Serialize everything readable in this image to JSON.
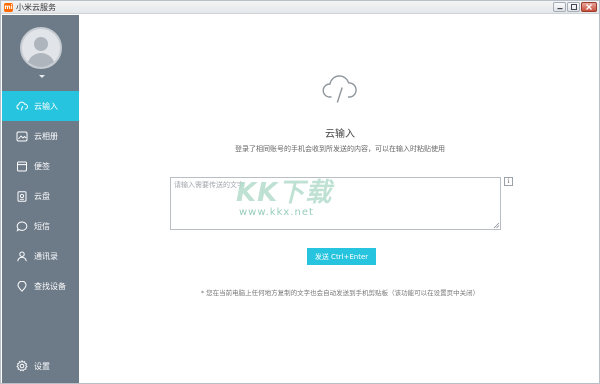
{
  "window": {
    "title": "小米云服务",
    "icon_text": "mi"
  },
  "sidebar": {
    "items": [
      {
        "label": "云输入",
        "icon": "cloud-input-icon",
        "active": true
      },
      {
        "label": "云相册",
        "icon": "photo-album-icon",
        "active": false
      },
      {
        "label": "便签",
        "icon": "notes-icon",
        "active": false
      },
      {
        "label": "云盘",
        "icon": "cloud-drive-icon",
        "active": false
      },
      {
        "label": "短信",
        "icon": "sms-icon",
        "active": false
      },
      {
        "label": "通讯录",
        "icon": "contacts-icon",
        "active": false
      },
      {
        "label": "查找设备",
        "icon": "find-device-icon",
        "active": false
      }
    ],
    "settings_label": "设置"
  },
  "main": {
    "title": "云输入",
    "description": "登录了相同账号的手机会收到所发送的内容，可以在输入时粘贴使用",
    "input_placeholder": "请输入需要传送的文字",
    "info_label": "i",
    "send_label": "发送 Ctrl+Enter",
    "hint": "* 您在当前电脑上任何地方复制的文字也会自动发送到手机剪贴板（该功能可以在设置页中关闭）"
  },
  "watermark": {
    "main": "KK下载",
    "url": "www.kkx.net"
  },
  "colors": {
    "sidebar_bg": "#6d7a88",
    "accent": "#26c4de"
  }
}
